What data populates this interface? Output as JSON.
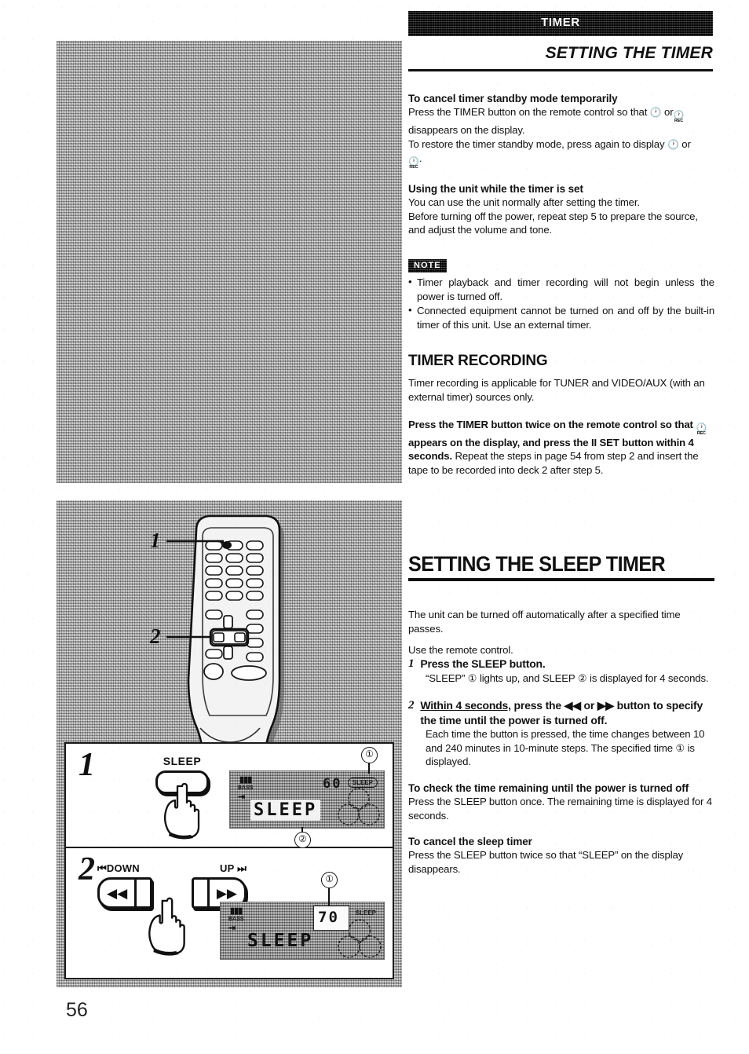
{
  "page": {
    "number": "56",
    "tab_label": "TIMER",
    "section_title": "SETTING THE TIMER"
  },
  "right_column": {
    "cancel_standby": {
      "heading": "To cancel timer standby mode temporarily",
      "line1_a": "Press the TIMER button on the remote control so that",
      "line1_b": "or",
      "line2": "disappears on the display.",
      "line3_a": "To restore the timer standby mode, press again to display",
      "line3_b": "or",
      "line4": "."
    },
    "using_unit": {
      "heading": "Using the unit while the timer is set",
      "line1": "You can use the unit normally after setting the timer.",
      "line2": "Before turning off the power, repeat step 5 to prepare the source, and adjust the volume and tone."
    },
    "note": {
      "tag": "NOTE",
      "items": [
        "Timer playback and timer recording will not begin unless the power is turned off.",
        "Connected equipment cannot be turned on and off by the built-in timer of this unit.  Use an external timer."
      ]
    },
    "timer_recording": {
      "heading": "TIMER RECORDING",
      "intro": "Timer recording is applicable for TUNER and VIDEO/AUX (with an external timer) sources only.",
      "instruction_a": "Press the TIMER button twice on the remote control so that",
      "instruction_b": "appears on the display, and press the II SET button within 4 seconds.",
      "instruction_c": "Repeat the steps in page 54 from step 2 and insert the tape to be recorded into deck 2 after step 5."
    },
    "sleep_timer": {
      "heading": "SETTING THE SLEEP TIMER",
      "intro": "The unit can be turned off automatically after a specified time passes.",
      "use_remote": "Use the remote control.",
      "step1": {
        "num": "1",
        "title": "Press the SLEEP button.",
        "body": "“SLEEP” ① lights up, and SLEEP ② is displayed for 4 seconds."
      },
      "step2": {
        "num": "2",
        "title_underlined": "Within 4 seconds,",
        "title_rest_a": "press the",
        "title_rest_b": "or",
        "title_rest_c": "button to specify the time until the power is turned off.",
        "body": "Each time the button is pressed, the time changes between 10 and 240 minutes in 10-minute steps.  The specified time ① is displayed."
      },
      "check_remaining": {
        "heading": "To check the time remaining until the power is turned off",
        "body": "Press the SLEEP button once.  The remaining time is displayed for 4 seconds."
      },
      "cancel_sleep": {
        "heading": "To cancel the sleep timer",
        "body": "Press the SLEEP button twice so that “SLEEP” on the display disappears."
      }
    }
  },
  "left_column": {
    "remote_figure": {
      "callout_1": "1",
      "callout_2": "2"
    },
    "step1_panel": {
      "step_number": "1",
      "button_label": "SLEEP",
      "display": {
        "bass_label": "BASS",
        "time_value": "60",
        "sleep_indicator": "SLEEP",
        "main_text": "SLEEP"
      },
      "callout_1": "①",
      "callout_2": "②"
    },
    "step2_panel": {
      "step_number": "2",
      "down_label": "DOWN",
      "down_prefix_icon": "skip-back-icon",
      "up_label": "UP",
      "up_suffix_icon": "skip-forward-icon",
      "down_glyph": "◀◀",
      "up_glyph": "▶▶",
      "display": {
        "bass_label": "BASS",
        "time_value": "70",
        "sleep_indicator": "SLEEP",
        "main_text": "SLEEP"
      },
      "callout_1": "①"
    }
  },
  "symbols": {
    "clock": "◷",
    "rec_label": "REC",
    "rewind": "◀◀",
    "fast_forward": "▶▶"
  }
}
